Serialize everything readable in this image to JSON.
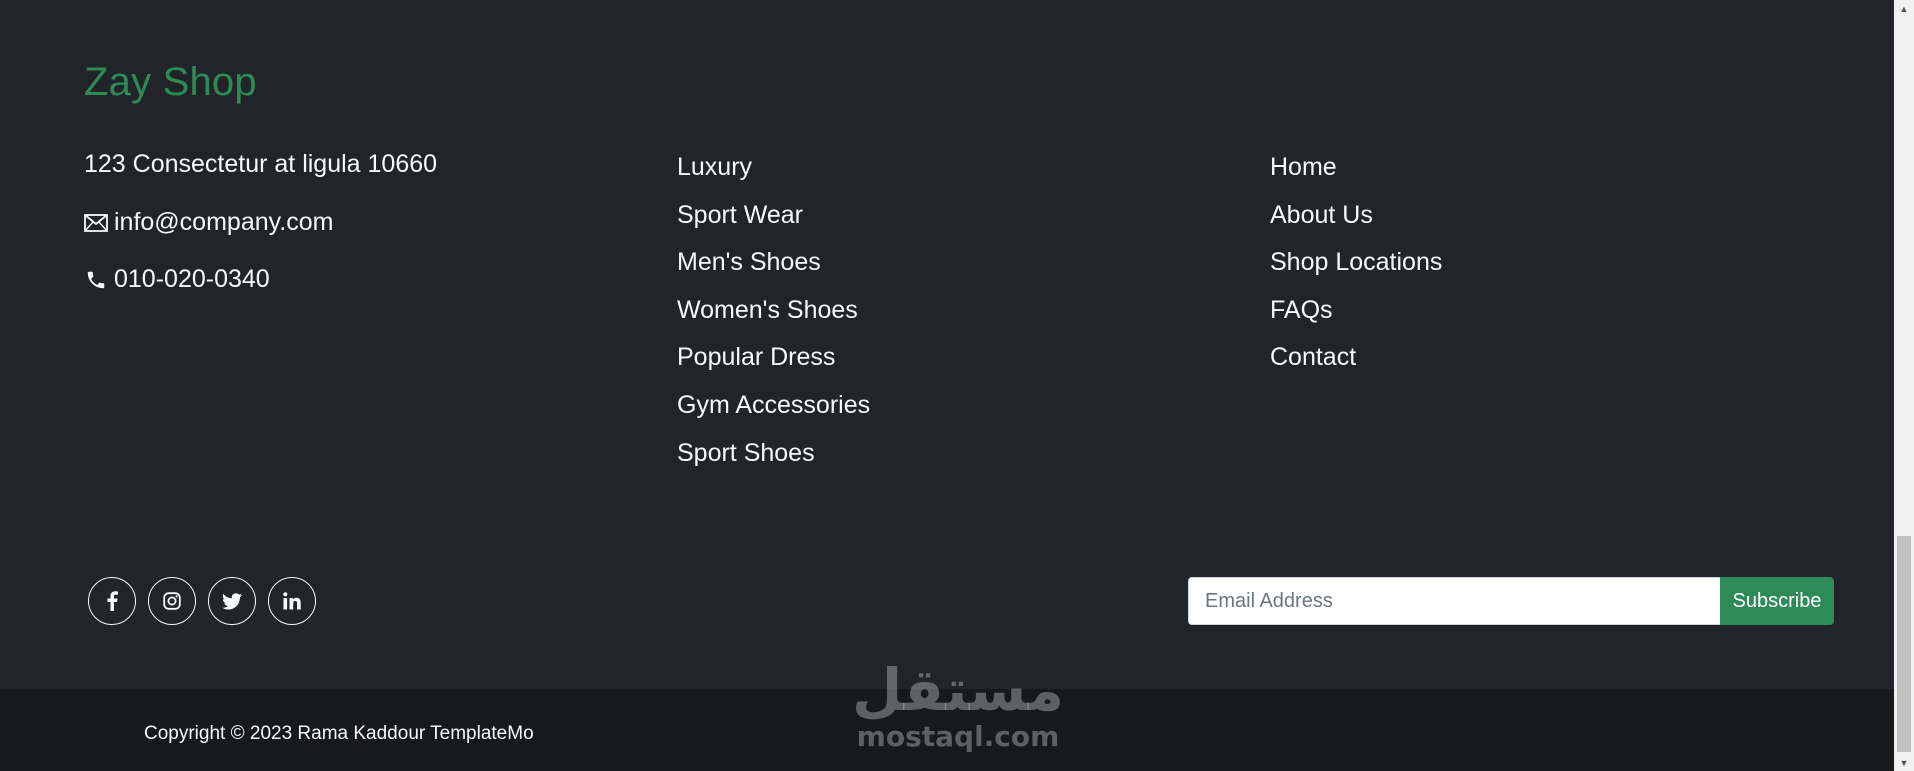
{
  "brand": "Zay Shop",
  "contact": {
    "address": "123 Consectetur at ligula 10660",
    "email": "info@company.com",
    "phone": "010-020-0340"
  },
  "products_links": [
    "Luxury",
    "Sport Wear",
    "Men's Shoes",
    "Women's Shoes",
    "Popular Dress",
    "Gym Accessories",
    "Sport Shoes"
  ],
  "info_links": [
    "Home",
    "About Us",
    "Shop Locations",
    "FAQs",
    "Contact"
  ],
  "socials": [
    "facebook-icon",
    "instagram-icon",
    "twitter-icon",
    "linkedin-icon"
  ],
  "subscribe": {
    "placeholder": "Email Address",
    "button": "Subscribe"
  },
  "copyright": "Copyright © 2023 Rama Kaddour TemplateMo",
  "watermark": {
    "arabic": "مستقل",
    "latin": "mostaql.com"
  },
  "colors": {
    "background": "#212529",
    "bottom_bar": "#171a1d",
    "accent": "#2e8b57",
    "text": "#f8f9fa"
  }
}
